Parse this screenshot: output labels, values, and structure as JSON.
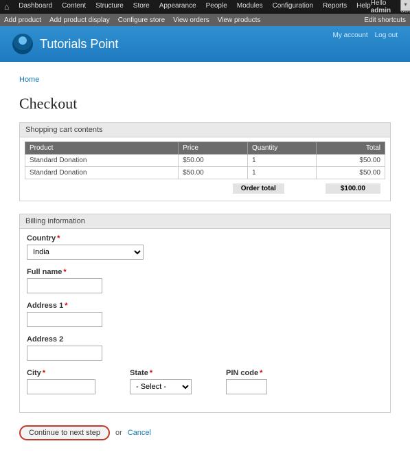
{
  "admin_menu": {
    "items": [
      "Dashboard",
      "Content",
      "Structure",
      "Store",
      "Appearance",
      "People",
      "Modules",
      "Configuration",
      "Reports",
      "Help"
    ],
    "hello": "Hello",
    "user": "admin",
    "logout": "Log out"
  },
  "shortcuts": {
    "items": [
      "Add product",
      "Add product display",
      "Configure store",
      "View orders",
      "View products"
    ],
    "edit": "Edit shortcuts"
  },
  "header": {
    "site_name": "Tutorials Point",
    "user_links": {
      "account": "My account",
      "logout": "Log out"
    }
  },
  "breadcrumb": "Home",
  "page_title": "Checkout",
  "cart": {
    "panel_title": "Shopping cart contents",
    "columns": {
      "product": "Product",
      "price": "Price",
      "qty": "Quantity",
      "total": "Total"
    },
    "rows": [
      {
        "product": "Standard Donation",
        "price": "$50.00",
        "qty": "1",
        "total": "$50.00"
      },
      {
        "product": "Standard Donation",
        "price": "$50.00",
        "qty": "1",
        "total": "$50.00"
      }
    ],
    "order_total_label": "Order total",
    "order_total_value": "$100.00"
  },
  "billing": {
    "panel_title": "Billing information",
    "fields": {
      "country": {
        "label": "Country",
        "value": "India"
      },
      "fullname": {
        "label": "Full name",
        "value": ""
      },
      "address1": {
        "label": "Address 1",
        "value": ""
      },
      "address2": {
        "label": "Address 2",
        "value": ""
      },
      "city": {
        "label": "City",
        "value": ""
      },
      "state": {
        "label": "State",
        "placeholder": "- Select -"
      },
      "pin": {
        "label": "PIN code",
        "value": ""
      }
    }
  },
  "actions": {
    "continue": "Continue to next step",
    "or": "or",
    "cancel": "Cancel"
  }
}
